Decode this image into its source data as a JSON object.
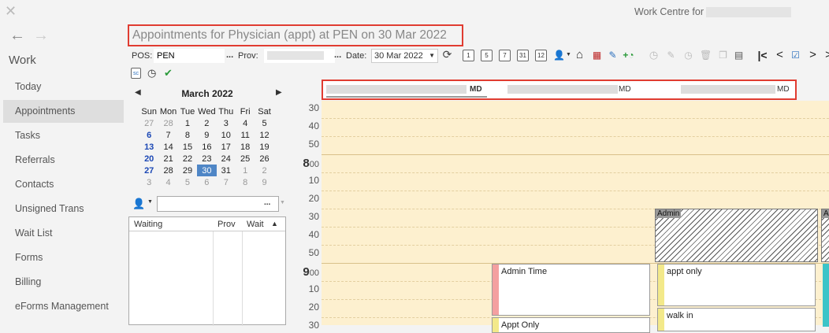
{
  "window": {
    "work_centre_label": "Work Centre for"
  },
  "sidebar": {
    "section_title": "Work",
    "items": [
      {
        "label": "Today"
      },
      {
        "label": "Appointments"
      },
      {
        "label": "Tasks"
      },
      {
        "label": "Referrals"
      },
      {
        "label": "Contacts"
      },
      {
        "label": "Unsigned Trans"
      },
      {
        "label": "Wait List"
      },
      {
        "label": "Forms"
      },
      {
        "label": "Billing"
      },
      {
        "label": "eForms Management"
      }
    ]
  },
  "page": {
    "title": "Appointments for Physician (appt) at PEN on 30 Mar 2022"
  },
  "toolbar": {
    "pos_label": "POS:",
    "pos_value": "PEN",
    "prov_label": "Prov:",
    "date_label": "Date:",
    "date_value": "30 Mar 2022",
    "dots": "...",
    "cal_icons": [
      "1",
      "5",
      "7",
      "31",
      "12"
    ]
  },
  "calendar": {
    "month_title": "March 2022",
    "weekdays": [
      "Sun",
      "Mon",
      "Tue",
      "Wed",
      "Thu",
      "Fri",
      "Sat"
    ],
    "weeks": [
      [
        "27",
        "28",
        "1",
        "2",
        "3",
        "4",
        "5"
      ],
      [
        "6",
        "7",
        "8",
        "9",
        "10",
        "11",
        "12"
      ],
      [
        "13",
        "14",
        "15",
        "16",
        "17",
        "18",
        "19"
      ],
      [
        "20",
        "21",
        "22",
        "23",
        "24",
        "25",
        "26"
      ],
      [
        "27",
        "28",
        "29",
        "30",
        "31",
        "1",
        "2"
      ],
      [
        "3",
        "4",
        "5",
        "6",
        "7",
        "8",
        "9"
      ]
    ],
    "selected": "30"
  },
  "waitlist": {
    "columns": [
      "Waiting",
      "Prov",
      "Wait"
    ],
    "dots": "..."
  },
  "providers": [
    {
      "suffix": "MD"
    },
    {
      "suffix": "MD"
    },
    {
      "suffix": "MD"
    }
  ],
  "schedule": {
    "time_labels": [
      {
        "text": "30",
        "hour": false
      },
      {
        "text": "40",
        "hour": false
      },
      {
        "text": "50",
        "hour": false
      },
      {
        "text": "8",
        "sup": "00",
        "hour": true
      },
      {
        "text": "10",
        "hour": false
      },
      {
        "text": "20",
        "hour": false
      },
      {
        "text": "30",
        "hour": false
      },
      {
        "text": "40",
        "hour": false
      },
      {
        "text": "50",
        "hour": false
      },
      {
        "text": "9",
        "sup": "00",
        "hour": true
      },
      {
        "text": "10",
        "hour": false
      },
      {
        "text": "20",
        "hour": false
      },
      {
        "text": "30",
        "hour": false
      }
    ],
    "appointments": [
      {
        "label": "Admin Time",
        "stripe": "#f4a0a0"
      },
      {
        "label": "Appt Only",
        "stripe": "#f3e98a"
      },
      {
        "label": "appt only",
        "stripe": "#f3e98a"
      },
      {
        "label": "walk in",
        "stripe": "#f3e98a"
      }
    ],
    "admin_blocks": [
      {
        "label": "Admin"
      },
      {
        "label": "Ad"
      }
    ],
    "colors": {
      "slot_bg": "#fdf0cf",
      "highlight_border": "#e03c31",
      "selected_day": "#4f86c6",
      "sunday": "#1c48b5"
    }
  }
}
